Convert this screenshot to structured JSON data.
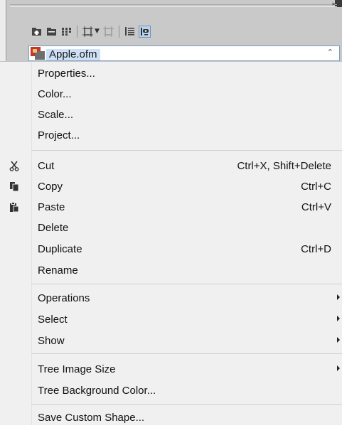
{
  "tree": {
    "selected_item": "Apple.ofm"
  },
  "toolbar": {
    "icons": [
      "add-folder-icon",
      "folder-icon",
      "grid-icon",
      "frame-icon",
      "dropdown-arrow-icon",
      "frame-faded-icon",
      "list-icon",
      "eye-view-icon"
    ]
  },
  "menu": {
    "group1": [
      {
        "label": "Properties..."
      },
      {
        "label": "Color..."
      },
      {
        "label": "Scale..."
      },
      {
        "label": "Project..."
      }
    ],
    "group2": [
      {
        "label": "Cut",
        "shortcut": "Ctrl+X, Shift+Delete",
        "icon": "scissors-icon"
      },
      {
        "label": "Copy",
        "shortcut": "Ctrl+C",
        "icon": "copy-icon"
      },
      {
        "label": "Paste",
        "shortcut": "Ctrl+V",
        "icon": "paste-icon"
      },
      {
        "label": "Delete"
      },
      {
        "label": "Duplicate",
        "shortcut": "Ctrl+D"
      },
      {
        "label": "Rename"
      }
    ],
    "group3": [
      {
        "label": "Operations",
        "submenu": true
      },
      {
        "label": "Select",
        "submenu": true
      },
      {
        "label": "Show",
        "submenu": true
      }
    ],
    "group4": [
      {
        "label": "Tree Image Size",
        "submenu": true
      },
      {
        "label": "Tree Background Color..."
      }
    ],
    "group5": [
      {
        "label": "Save Custom Shape..."
      }
    ]
  },
  "colors": {
    "menu_bg": "#f0f0f0",
    "separator": "#d0d0d0",
    "selection": "#cde0f5"
  }
}
